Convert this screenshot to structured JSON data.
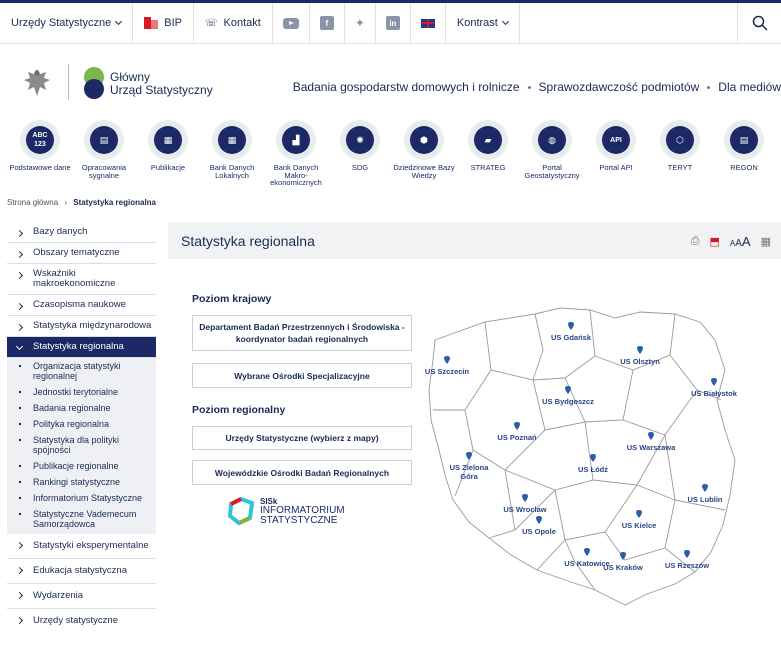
{
  "topbar": {
    "offices_label": "Urzędy Statystyczne",
    "bip_label": "BIP",
    "contact_label": "Kontakt",
    "contrast_label": "Kontrast"
  },
  "logo": {
    "line1": "Główny",
    "line2": "Urząd Statystyczny"
  },
  "mainnav": [
    "Badania gospodarstw domowych i rolnicze",
    "Sprawozdawczość podmiotów",
    "Dla mediów"
  ],
  "icons": [
    {
      "label": "Podstawowe dane",
      "glyph": "ABC 123"
    },
    {
      "label": "Opracowania sygnalne",
      "glyph": "signal"
    },
    {
      "label": "Publikacje",
      "glyph": "pub"
    },
    {
      "label": "Bank Danych Lokalnych",
      "glyph": "grid"
    },
    {
      "label": "Bank Danych Makro-ekonomicznych",
      "glyph": "blocks"
    },
    {
      "label": "SDG",
      "glyph": "sdg"
    },
    {
      "label": "Dziedzinowe Bazy Wiedzy",
      "glyph": "cube"
    },
    {
      "label": "STRATEG",
      "glyph": "strateg"
    },
    {
      "label": "Portal Geostatystyczny",
      "glyph": "globe"
    },
    {
      "label": "Portal API",
      "glyph": "api"
    },
    {
      "label": "TERYT",
      "glyph": "map"
    },
    {
      "label": "REGON",
      "glyph": "doc"
    }
  ],
  "breadcrumb": {
    "home": "Strona główna",
    "current": "Statystyka regionalna"
  },
  "sidebar": {
    "items_top": [
      "Bazy danych",
      "Obszary tematyczne",
      "Wskaźniki makroekonomiczne",
      "Czasopisma naukowe",
      "Statystyka międzynarodowa"
    ],
    "active": "Statystyka regionalna",
    "subitems": [
      "Organizacja statystyki regionalnej",
      "Jednostki terytorialne",
      "Badania regionalne",
      "Polityka regionalna",
      "Statystyka dla polityki spójności",
      "Publikacje regionalne",
      "Rankingi statystyczne",
      "Informatorium Statystyczne",
      "Statystyczne Vademecum Samorządowca"
    ],
    "items_bottom": [
      "Statystyki eksperymentalne",
      "Edukacja statystyczna",
      "Wydarzenia",
      "Urzędy statystyczne"
    ]
  },
  "content": {
    "title": "Statystyka regionalna",
    "national_heading": "Poziom krajowy",
    "btn_dept": "Departament Badań Przestrzennych i Środowiska - koordynator badań regionalnych",
    "btn_centers": "Wybrane Ośrodki Specjalizacyjne",
    "regional_heading": "Poziom regionalny",
    "btn_offices": "Urzędy Statystyczne (wybierz z mapy)",
    "btn_regional_centers": "Wojewódzkie Ośrodki Badań Regionalnych",
    "sisk": {
      "line1": "SISk",
      "line2": "INFORMATORIUM",
      "line3": "STATYSTYCZNE"
    }
  },
  "map_cities": [
    {
      "name": "US Gdańsk"
    },
    {
      "name": "US Olsztyn"
    },
    {
      "name": "US Szczecin"
    },
    {
      "name": "US Białystok"
    },
    {
      "name": "US Bydgoszcz"
    },
    {
      "name": "US Poznań"
    },
    {
      "name": "US Warszawa"
    },
    {
      "name": "US Zielona Góra"
    },
    {
      "name": "US Łódź"
    },
    {
      "name": "US Wrocław"
    },
    {
      "name": "US Lublin"
    },
    {
      "name": "US Opole"
    },
    {
      "name": "US Kielce"
    },
    {
      "name": "US Katowice"
    },
    {
      "name": "US Kraków"
    },
    {
      "name": "US Rzeszów"
    }
  ],
  "colors": {
    "navy": "#1b2a66",
    "accent_red": "#d71a28",
    "map_stroke": "#999999"
  }
}
